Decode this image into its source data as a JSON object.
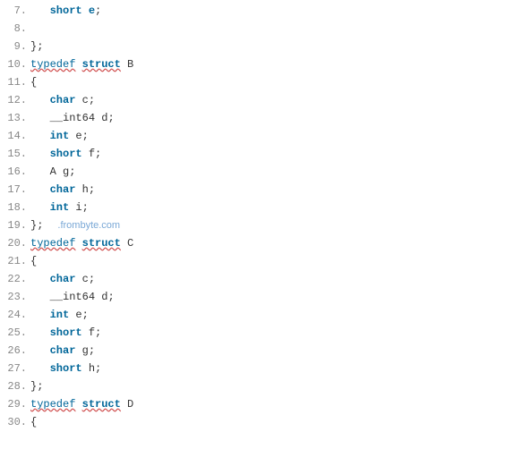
{
  "watermark": ".frombyte.com",
  "lines": [
    {
      "num": "7.",
      "indent": "   ",
      "tokens": [
        [
          "kw",
          "short"
        ],
        [
          "",
          ""
        ],
        [
          "",
          " "
        ],
        [
          "kw",
          "e"
        ],
        [
          "punct",
          ";"
        ]
      ]
    },
    {
      "num": "8.",
      "indent": "",
      "tokens": []
    },
    {
      "num": "9.",
      "indent": "",
      "tokens": [
        [
          "punct",
          "};"
        ]
      ]
    },
    {
      "num": "10.",
      "indent": "",
      "tokens": [
        [
          "typedef",
          "typedef"
        ],
        [
          "",
          " "
        ],
        [
          "struct",
          "struct"
        ],
        [
          "",
          " "
        ],
        [
          "ident",
          "B"
        ]
      ]
    },
    {
      "num": "11.",
      "indent": "",
      "tokens": [
        [
          "punct",
          "{"
        ]
      ]
    },
    {
      "num": "12.",
      "indent": "   ",
      "tokens": [
        [
          "kw",
          "char"
        ],
        [
          "",
          " "
        ],
        [
          "ident",
          "c"
        ],
        [
          "punct",
          ";"
        ]
      ]
    },
    {
      "num": "13.",
      "indent": "   ",
      "tokens": [
        [
          "ident",
          "__int64"
        ],
        [
          "",
          " "
        ],
        [
          "ident",
          "d"
        ],
        [
          "punct",
          ";"
        ]
      ]
    },
    {
      "num": "14.",
      "indent": "   ",
      "tokens": [
        [
          "kw",
          "int"
        ],
        [
          "",
          " "
        ],
        [
          "ident",
          "e"
        ],
        [
          "punct",
          ";"
        ]
      ]
    },
    {
      "num": "15.",
      "indent": "   ",
      "tokens": [
        [
          "kw",
          "short"
        ],
        [
          "",
          " "
        ],
        [
          "ident",
          "f"
        ],
        [
          "punct",
          ";"
        ]
      ]
    },
    {
      "num": "16.",
      "indent": "   ",
      "tokens": [
        [
          "ident",
          "A"
        ],
        [
          "",
          " "
        ],
        [
          "ident",
          "g"
        ],
        [
          "punct",
          ";"
        ]
      ]
    },
    {
      "num": "17.",
      "indent": "   ",
      "tokens": [
        [
          "kw",
          "char"
        ],
        [
          "",
          " "
        ],
        [
          "ident",
          "h"
        ],
        [
          "punct",
          ";"
        ]
      ]
    },
    {
      "num": "18.",
      "indent": "   ",
      "tokens": [
        [
          "kw",
          "int"
        ],
        [
          "",
          " "
        ],
        [
          "ident",
          "i"
        ],
        [
          "punct",
          ";"
        ]
      ]
    },
    {
      "num": "19.",
      "indent": "",
      "tokens": [
        [
          "punct",
          "};"
        ],
        [
          "watermark",
          ""
        ]
      ]
    },
    {
      "num": "20.",
      "indent": "",
      "tokens": [
        [
          "typedef",
          "typedef"
        ],
        [
          "",
          " "
        ],
        [
          "struct",
          "struct"
        ],
        [
          "",
          " "
        ],
        [
          "ident",
          "C"
        ]
      ]
    },
    {
      "num": "21.",
      "indent": "",
      "tokens": [
        [
          "punct",
          "{"
        ]
      ]
    },
    {
      "num": "22.",
      "indent": "   ",
      "tokens": [
        [
          "kw",
          "char"
        ],
        [
          "",
          " "
        ],
        [
          "ident",
          "c"
        ],
        [
          "punct",
          ";"
        ]
      ]
    },
    {
      "num": "23.",
      "indent": "   ",
      "tokens": [
        [
          "ident",
          "__int64"
        ],
        [
          "",
          " "
        ],
        [
          "ident",
          "d"
        ],
        [
          "punct",
          ";"
        ]
      ]
    },
    {
      "num": "24.",
      "indent": "   ",
      "tokens": [
        [
          "kw",
          "int"
        ],
        [
          "",
          " "
        ],
        [
          "ident",
          "e"
        ],
        [
          "punct",
          ";"
        ]
      ]
    },
    {
      "num": "25.",
      "indent": "   ",
      "tokens": [
        [
          "kw",
          "short"
        ],
        [
          "",
          " "
        ],
        [
          "ident",
          "f"
        ],
        [
          "punct",
          ";"
        ]
      ]
    },
    {
      "num": "26.",
      "indent": "   ",
      "tokens": [
        [
          "kw",
          "char"
        ],
        [
          "",
          " "
        ],
        [
          "ident",
          "g"
        ],
        [
          "punct",
          ";"
        ]
      ]
    },
    {
      "num": "27.",
      "indent": "   ",
      "tokens": [
        [
          "kw",
          "short"
        ],
        [
          "",
          " "
        ],
        [
          "ident",
          "h"
        ],
        [
          "punct",
          ";"
        ]
      ]
    },
    {
      "num": "28.",
      "indent": "",
      "tokens": [
        [
          "punct",
          "};"
        ]
      ]
    },
    {
      "num": "29.",
      "indent": "",
      "tokens": [
        [
          "typedef",
          "typedef"
        ],
        [
          "",
          " "
        ],
        [
          "struct",
          "struct"
        ],
        [
          "",
          " "
        ],
        [
          "ident",
          "D"
        ]
      ]
    },
    {
      "num": "30.",
      "indent": "",
      "tokens": [
        [
          "punct",
          "{"
        ]
      ]
    }
  ]
}
